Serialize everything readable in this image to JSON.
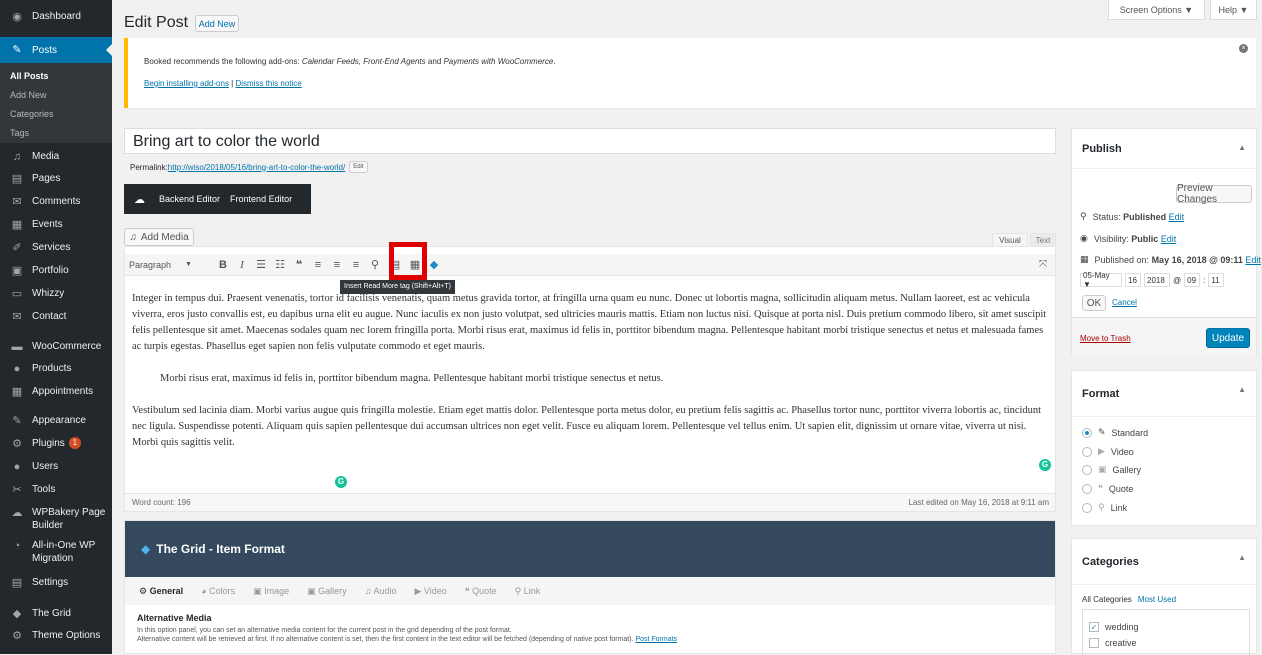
{
  "sidebar": {
    "items": [
      {
        "label": "Dashboard",
        "icon": "dashboard-icon",
        "glyph": "◉"
      },
      {
        "label": "Posts",
        "icon": "pin-icon",
        "glyph": "✎"
      },
      {
        "label": "Media",
        "icon": "media-icon",
        "glyph": "♫"
      },
      {
        "label": "Pages",
        "icon": "pages-icon",
        "glyph": "▤"
      },
      {
        "label": "Comments",
        "icon": "comments-icon",
        "glyph": "✉"
      },
      {
        "label": "Events",
        "icon": "calendar-icon",
        "glyph": "▦"
      },
      {
        "label": "Services",
        "icon": "services-icon",
        "glyph": "✐"
      },
      {
        "label": "Portfolio",
        "icon": "portfolio-icon",
        "glyph": "▣"
      },
      {
        "label": "Whizzy",
        "icon": "whizzy-icon",
        "glyph": "▭"
      },
      {
        "label": "Contact",
        "icon": "contact-icon",
        "glyph": "✉"
      },
      {
        "label": "WooCommerce",
        "icon": "woocommerce-icon",
        "glyph": "▬"
      },
      {
        "label": "Products",
        "icon": "products-icon",
        "glyph": "●"
      },
      {
        "label": "Appointments",
        "icon": "appointments-icon",
        "glyph": "▦"
      },
      {
        "label": "Appearance",
        "icon": "appearance-icon",
        "glyph": "✎"
      },
      {
        "label": "Plugins",
        "icon": "plugins-icon",
        "glyph": "⚙"
      },
      {
        "label": "Users",
        "icon": "users-icon",
        "glyph": "●"
      },
      {
        "label": "Tools",
        "icon": "tools-icon",
        "glyph": "✂"
      },
      {
        "label": "WPBakery Page Builder",
        "icon": "wpbakery-icon",
        "glyph": "☁"
      },
      {
        "label": "All-in-One WP Migration",
        "icon": "migration-icon",
        "glyph": "◔"
      },
      {
        "label": "Settings",
        "icon": "settings-icon",
        "glyph": "▤"
      },
      {
        "label": "The Grid",
        "icon": "grid-icon",
        "glyph": "◆"
      },
      {
        "label": "Theme Options",
        "icon": "theme-options-icon",
        "glyph": "⚙"
      }
    ],
    "submenu": [
      "All Posts",
      "Add New",
      "Categories",
      "Tags"
    ],
    "plugins_badge": "1"
  },
  "header": {
    "title": "Edit Post",
    "add_new": "Add New",
    "screen_options": "Screen Options ▼",
    "help": "Help ▼"
  },
  "notice": {
    "text_before": "Booked recommends the following add-ons: ",
    "addons": "Calendar Feeds, Front-End Agents",
    "text_and": " and ",
    "addon_last": "Payments with WooCommerce",
    "text_end": ".",
    "install_link": "Begin installing add-ons",
    "separator": " | ",
    "dismiss_link": "Dismiss this notice"
  },
  "post": {
    "title": "Bring art to color the world",
    "permalink_label": "Permalink: ",
    "permalink_url": "http://wiso/2018/05/16/bring-art-to-color-the-world/",
    "edit_label": "Edit"
  },
  "vc": {
    "backend": "Backend Editor",
    "frontend": "Frontend Editor"
  },
  "editor": {
    "add_media": "Add Media",
    "tab_visual": "Visual",
    "tab_text": "Text",
    "format_select": "Paragraph",
    "tooltip": "Insert Read More tag (Shift+Alt+T)",
    "paragraphs": [
      "Integer in tempus dui. Praesent venenatis, tortor id facilisis venenatis, quam metus gravida tortor, at fringilla urna quam eu nunc. Donec ut lobortis magna, sollicitudin aliquam metus. Nullam laoreet, est ac vehicula viverra, eros justo convallis est, eu dapibus urna elit eu augue. Nunc iaculis ex non justo volutpat, sed ultricies mauris mattis. Etiam non luctus nisi. Quisque at porta nisl. Duis pretium commodo libero, sit amet suscipit felis pellentesque sit amet. Maecenas sodales quam nec lorem fringilla porta. Morbi risus erat, maximus id felis in, porttitor bibendum magna. Pellentesque habitant morbi tristique senectus et netus et malesuada fames ac turpis egestas. Phasellus eget sapien non felis vulputate commodo et eget mauris.",
      "Morbi risus erat, maximus id felis in, porttitor bibendum magna. Pellentesque habitant morbi tristique senectus et netus.",
      "Vestibulum sed lacinia diam. Morbi varius augue quis fringilla molestie. Etiam eget mattis dolor. Pellentesque porta metus dolor, eu pretium felis sagittis ac. Phasellus tortor nunc, porttitor viverra lobortis ac, tincidunt nec ligula. Suspendisse potenti. Aliquam quis sapien pellentesque dui accumsan ultrices non eget velit. Fusce eu aliquam lorem. Pellentesque vel tellus enim. Ut sapien elit, dignissim ut ornare vitae, viverra ut nisi. Morbi quis sagittis velit."
    ],
    "word_count": "Word count: 196",
    "last_edited": "Last edited on May 16, 2018 at 9:11 am"
  },
  "grid": {
    "title": "The Grid - Item Format",
    "tabs": [
      "General",
      "Colors",
      "Image",
      "Gallery",
      "Audio",
      "Video",
      "Quote",
      "Link"
    ],
    "alt_media_title": "Alternative Media",
    "desc1": "In this option panel, you can set an alternative media content for the current post in the grid depending of the post format.",
    "desc2": "Alternative content will be retrieved at first. If no alternative content is set, then the first content in the text editor will be fetched (depending of native post format). ",
    "post_formats_link": "Post Formats"
  },
  "publish": {
    "title": "Publish",
    "preview": "Preview Changes",
    "status_label": "Status: ",
    "status_value": "Published",
    "visibility_label": "Visibility: ",
    "visibility_value": "Public",
    "published_on_label": "Published on: ",
    "published_on_value": "May 16, 2018 @ 09:11",
    "edit": "Edit",
    "month": "05-May ▼",
    "day": "16",
    "year": "2018",
    "at": "@",
    "hour": "09",
    "colon": ":",
    "minute": "11",
    "ok": "OK",
    "cancel": "Cancel",
    "trash": "Move to Trash",
    "update": "Update"
  },
  "format": {
    "title": "Format",
    "options": [
      {
        "label": "Standard",
        "icon": "pin-icon",
        "glyph": "✎",
        "checked": true
      },
      {
        "label": "Video",
        "icon": "video-icon",
        "glyph": "▶",
        "checked": false
      },
      {
        "label": "Gallery",
        "icon": "gallery-icon",
        "glyph": "▣",
        "checked": false
      },
      {
        "label": "Quote",
        "icon": "quote-icon",
        "glyph": "❝",
        "checked": false
      },
      {
        "label": "Link",
        "icon": "link-icon",
        "glyph": "⚲",
        "checked": false
      }
    ]
  },
  "categories": {
    "title": "Categories",
    "tab_all": "All Categories",
    "tab_used": "Most Used",
    "items": [
      {
        "label": "wedding",
        "checked": true
      },
      {
        "label": "creative",
        "checked": false
      }
    ]
  },
  "colors": {
    "sidebar_bg": "#23282d",
    "accent": "#0073aa",
    "notice_border": "#ffb900",
    "grid_header": "#34495e",
    "highlight": "#e00000",
    "grammarly": "#15c39a"
  }
}
